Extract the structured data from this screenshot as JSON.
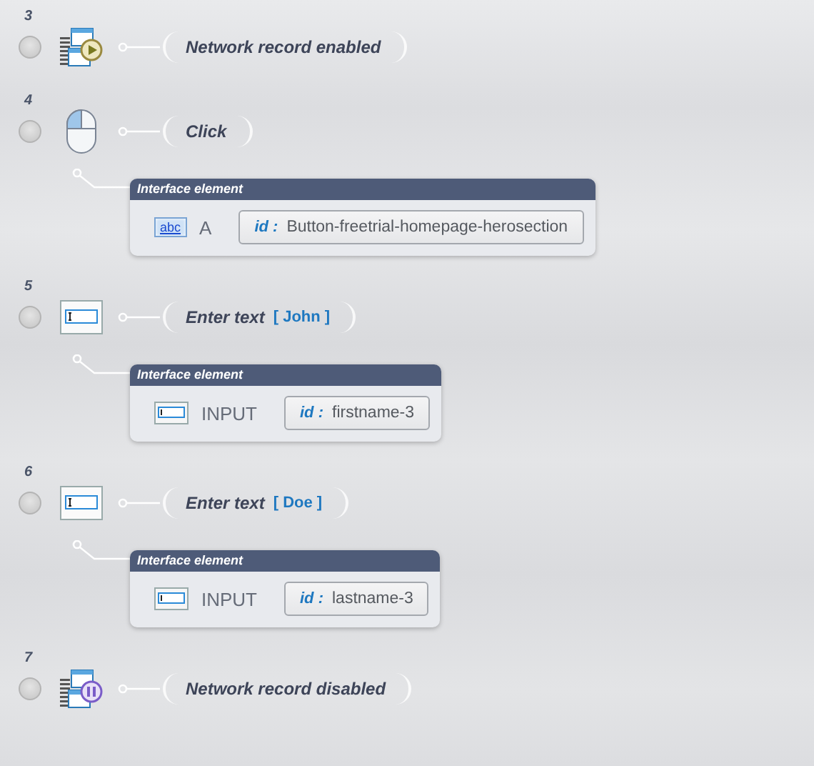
{
  "steps": [
    {
      "number": "3",
      "kind": "network_on",
      "title": "Network record enabled"
    },
    {
      "number": "4",
      "kind": "click",
      "title": "Click",
      "element": {
        "header": "Interface element",
        "kind": "link",
        "icon_text": "abc",
        "tag": "A",
        "id_label": "id :",
        "id_value": "Button-freetrial-homepage-herosection"
      }
    },
    {
      "number": "5",
      "kind": "input",
      "title": "Enter text",
      "value": "[ John ]",
      "element": {
        "header": "Interface element",
        "kind": "input",
        "tag": "INPUT",
        "id_label": "id :",
        "id_value": "firstname-3"
      }
    },
    {
      "number": "6",
      "kind": "input",
      "title": "Enter text",
      "value": "[ Doe ]",
      "element": {
        "header": "Interface element",
        "kind": "input",
        "tag": "INPUT",
        "id_label": "id :",
        "id_value": "lastname-3"
      }
    },
    {
      "number": "7",
      "kind": "network_off",
      "title": "Network record disabled"
    }
  ]
}
